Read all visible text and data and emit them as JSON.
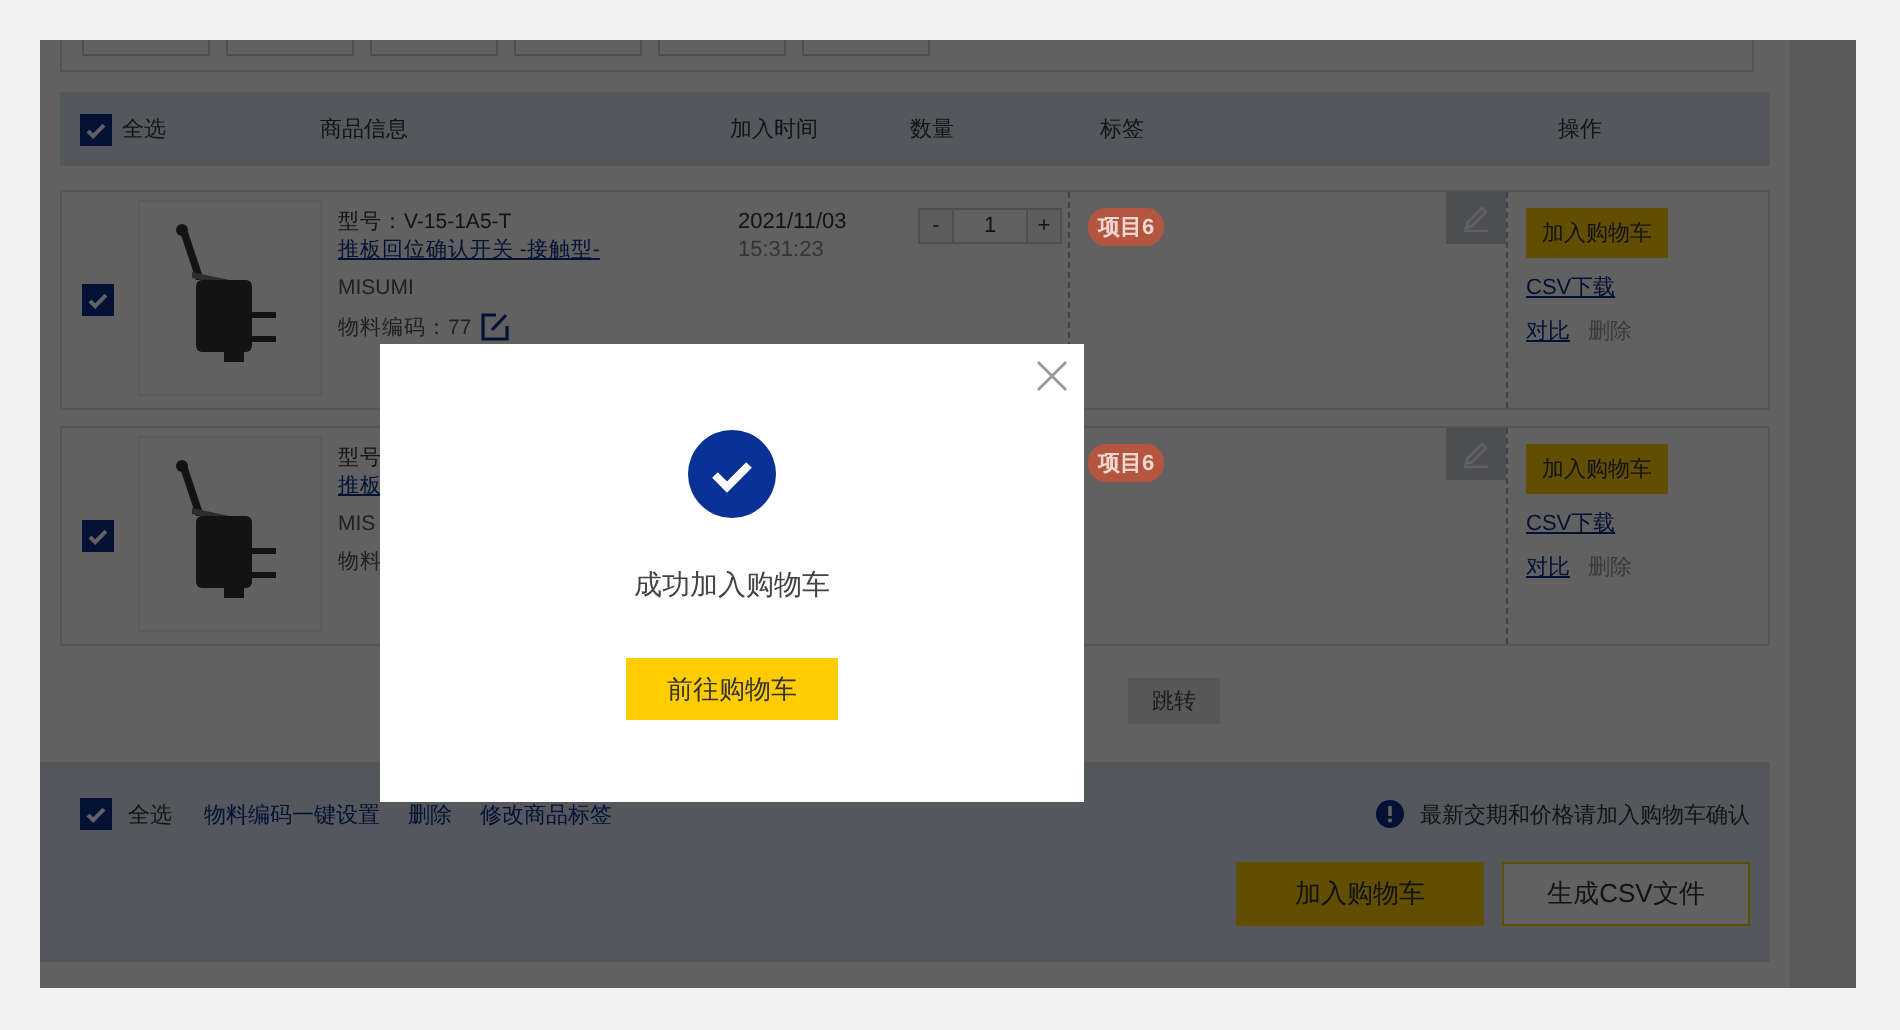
{
  "header": {
    "select_all": {
      "label": "全选",
      "checked": true
    },
    "columns": [
      "商品信息",
      "加入时间",
      "数量",
      "标签",
      "操作"
    ]
  },
  "rows": [
    {
      "checked": true,
      "model": "型号：V-15-1A5-T",
      "name": "推板回位确认开关 -接触型-",
      "brand": "MISUMI",
      "code": "物料编码：77",
      "date": "2021/11/03",
      "time": "15:31:23",
      "quantity": "1",
      "quantity_buttons": [
        "-",
        "+"
      ],
      "tag": {
        "label": "项目6",
        "color": "#b4563f"
      },
      "actions": {
        "add": "加入购物车",
        "csv": "CSV下载",
        "compare": "对比",
        "delete": "删除"
      }
    },
    {
      "checked": true,
      "model": "型号",
      "name": "推板",
      "brand": "MIS",
      "code": "物料",
      "tag": {
        "label": "项目6",
        "color": "#b4563f"
      },
      "actions": {
        "add": "加入购物车",
        "csv": "CSV下载",
        "compare": "对比",
        "delete": "删除"
      }
    }
  ],
  "pagination": {
    "jump_button": "跳转"
  },
  "footer": {
    "select_all": {
      "label": "全选",
      "checked": true
    },
    "links": [
      "物料编码一键设置",
      "删除",
      "修改商品标签"
    ],
    "notice": "最新交期和价格请加入购物车确认",
    "buttons": [
      {
        "label": "加入购物车",
        "kind": "primary"
      },
      {
        "label": "生成CSV文件",
        "kind": "outline"
      }
    ]
  },
  "dialog": {
    "message": "成功加入购物车",
    "button": "前往购物车"
  }
}
